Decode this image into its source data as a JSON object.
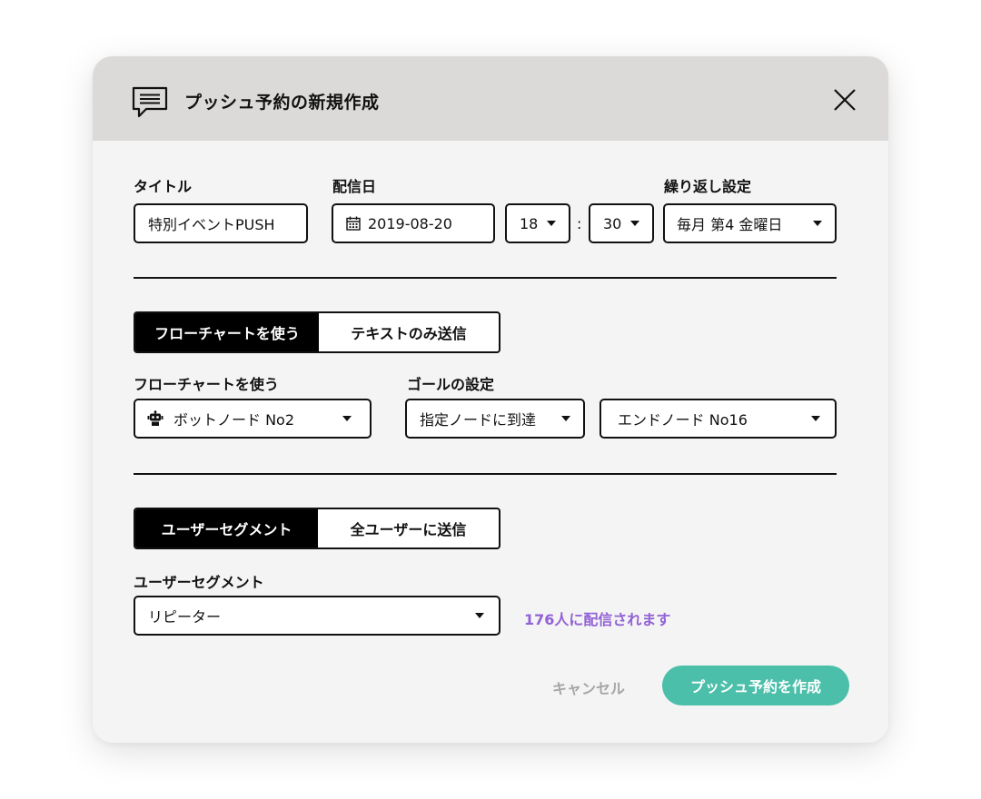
{
  "dialog": {
    "title": "プッシュ予約の新規作成",
    "icons": {
      "header": "chat-message-icon",
      "close": "close-icon"
    }
  },
  "schedule": {
    "title_label": "タイトル",
    "title_value": "特別イベントPUSH",
    "date_label": "配信日",
    "date_value": "2019-08-20",
    "date_icon": "calendar-icon",
    "hour_value": "18",
    "time_separator": ":",
    "minute_value": "30",
    "repeat_label": "繰り返し設定",
    "repeat_value": "毎月 第4 金曜日"
  },
  "flow": {
    "tabs": [
      "フローチャートを使う",
      "テキストのみ送信"
    ],
    "active_tab": 0,
    "flowchart_label": "フローチャートを使う",
    "flowchart_value": "ボットノード No2",
    "flowchart_icon": "robot-icon",
    "goal_label": "ゴールの設定",
    "goal_type_value": "指定ノードに到達",
    "goal_node_value": "エンドノード No16"
  },
  "audience": {
    "tabs": [
      "ユーザーセグメント",
      "全ユーザーに送信"
    ],
    "active_tab": 0,
    "segment_label": "ユーザーセグメント",
    "segment_value": "リピーター",
    "recipients_info": "176人に配信されます"
  },
  "footer": {
    "cancel_label": "キャンセル",
    "submit_label": "プッシュ予約を作成"
  },
  "colors": {
    "header_bg": "#dcdad8",
    "dialog_bg": "#f4f4f4",
    "primary": "#4bbfaa",
    "info_text": "#9262d6",
    "cancel_text": "#a6a6a6",
    "active_tab_bg": "#000000"
  }
}
